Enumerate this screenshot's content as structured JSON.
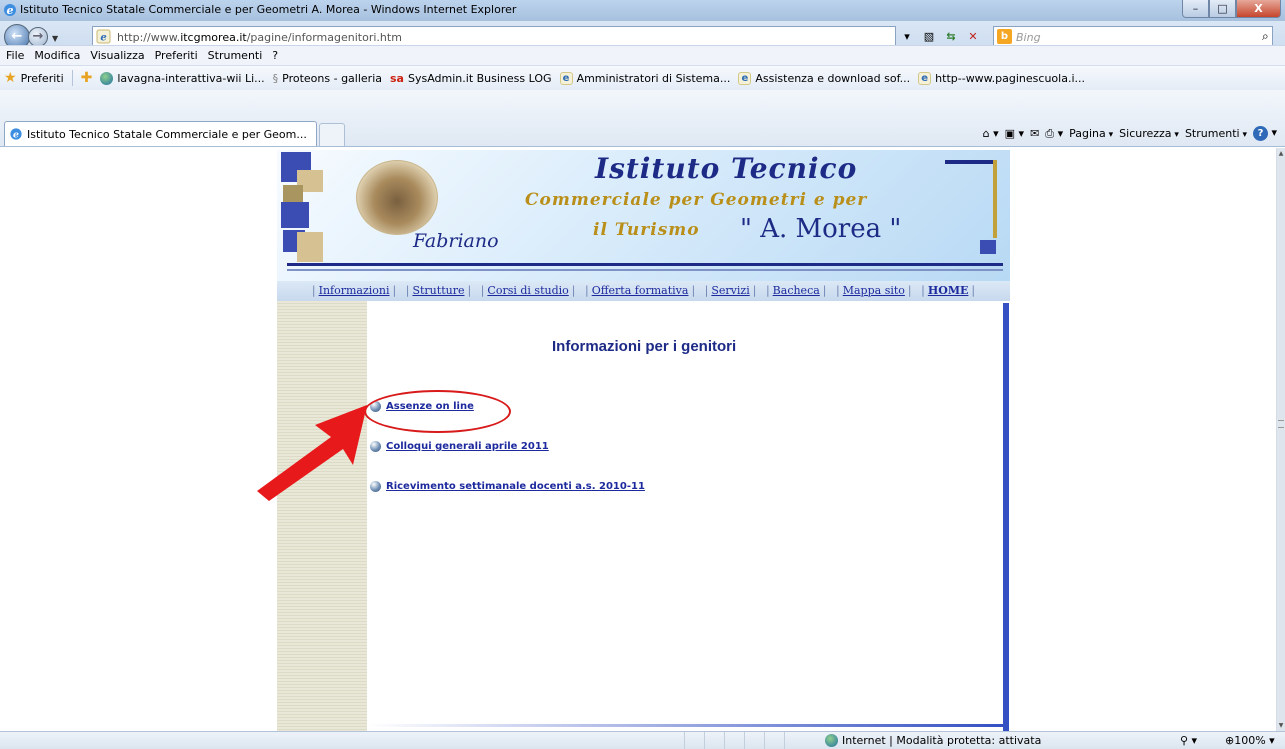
{
  "window": {
    "title": "Istituto Tecnico Statale Commerciale e per Geometri A. Morea - Windows Internet Explorer",
    "controls": [
      "–",
      "□",
      "X"
    ]
  },
  "address": {
    "url_prefix": "http://www.",
    "url_domain": "itcgmorea.it",
    "url_path": "/pagine/informagenitori.htm"
  },
  "search": {
    "placeholder": "Bing"
  },
  "menu": [
    "File",
    "Modifica",
    "Visualizza",
    "Preferiti",
    "Strumenti",
    "?"
  ],
  "favorites": {
    "label": "Preferiti",
    "items": [
      "lavagna-interattiva-wii Li...",
      "Proteons - galleria",
      "SysAdmin.it Business LOG",
      "Amministratori di Sistema...",
      "Assistenza e download sof...",
      "http--www.paginescuola.i..."
    ]
  },
  "tab": {
    "title": "Istituto Tecnico Statale Commerciale e per Geom..."
  },
  "commandbar": {
    "page": "Pagina",
    "security": "Sicurezza",
    "tools": "Strumenti"
  },
  "site": {
    "banner": {
      "title": "Istituto Tecnico",
      "subtitle1": "Commerciale per Geometri e per",
      "subtitle2": "il Turismo",
      "name": "\" A. Morea \"",
      "city": "Fabriano"
    },
    "nav": [
      "Informazioni",
      "Strutture",
      "Corsi di studio",
      "Offerta formativa",
      "Servizi",
      "Bacheca",
      "Mappa sito",
      "HOME"
    ],
    "heading": "Informazioni per i genitori",
    "links": [
      "Assenze on line",
      "Colloqui generali aprile 2011",
      "Ricevimento settimanale docenti a.s. 2010-11"
    ]
  },
  "status": {
    "zone": "Internet | Modalità protetta: attivata",
    "zoom": "100%"
  },
  "colors": {
    "annotation": "#d81a1a",
    "site_blue": "#1d2a86",
    "site_gold": "#b98f1a"
  }
}
